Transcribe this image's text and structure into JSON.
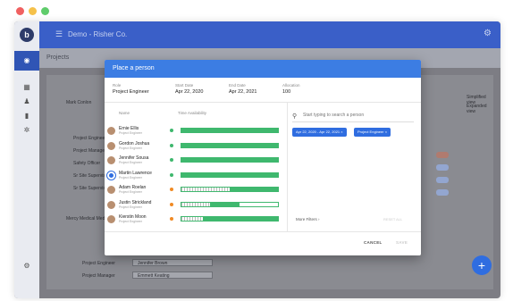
{
  "colors": {
    "dot_red": "#f06060",
    "dot_yellow": "#f5c14a",
    "dot_green": "#5fcc6b",
    "accent": "#3c7de3",
    "bar_green": "#3fb86e",
    "status_green": "#3fb86e",
    "status_orange": "#f08a24"
  },
  "app": {
    "logo_letter": "b",
    "title": "Demo - Risher Co.",
    "menu_icon": "menu-icon",
    "settings_icon": "gear-icon"
  },
  "subbar": {
    "label": "Projects"
  },
  "background": {
    "rows": [
      {
        "label": "Mark Conlon"
      },
      {
        "label": "Project Engineer"
      },
      {
        "label": "Project Manager"
      },
      {
        "label": "Safety Officer"
      },
      {
        "label": "Sr Site Supervisor"
      },
      {
        "label": "Sr Site Supervisor"
      },
      {
        "label": "Mercy Medical Medical Center"
      },
      {
        "label": "Project Engineer"
      },
      {
        "label": "Project Manager"
      }
    ],
    "right_options": [
      "Simplified view",
      "Expanded view"
    ],
    "fields": [
      "Jennifer Brown",
      "Emmett Keating"
    ]
  },
  "modal": {
    "title": "Place a person",
    "meta": [
      {
        "key": "Role",
        "value": "Project Engineer"
      },
      {
        "key": "Start Date",
        "value": "Apr 22, 2020"
      },
      {
        "key": "End Date",
        "value": "Apr 22, 2021"
      },
      {
        "key": "Allocation",
        "value": "100"
      }
    ],
    "col_name": "Name",
    "col_availability": "Time Availability",
    "people": [
      {
        "name": "Ernie Ellis",
        "role": "Project Engineer",
        "status": "green",
        "fill": 1.0,
        "hatch": 0
      },
      {
        "name": "Gordon Joshua",
        "role": "Project Engineer",
        "status": "green",
        "fill": 1.0,
        "hatch": 0
      },
      {
        "name": "Jennifer Sousa",
        "role": "Project Engineer",
        "status": "green",
        "fill": 1.0,
        "hatch": 0
      },
      {
        "name": "Martin Lawrence",
        "role": "Project Engineer",
        "status": "green",
        "fill": 1.0,
        "hatch": 0,
        "selected": true
      },
      {
        "name": "Adam Roelan",
        "role": "Project Engineer",
        "status": "orange",
        "fill": 0.5,
        "hatch": 0.5
      },
      {
        "name": "Justin Strickland",
        "role": "Project Engineer",
        "status": "orange",
        "fill": 0.3,
        "hatch": 0.3
      },
      {
        "name": "Kierstin Moon",
        "role": "Project Engineer",
        "status": "orange",
        "fill": 0.8,
        "hatch": 0.22
      }
    ],
    "search_placeholder": "Start typing to search a person",
    "search_icon": "search-icon",
    "chips": [
      {
        "label": "Apr 22, 2020 - Apr 22, 2021",
        "close": "×"
      },
      {
        "label": "Project Engineer",
        "close": "×"
      }
    ],
    "more_filters": "More Filters",
    "reset_all": "RESET ALL",
    "cancel": "CANCEL",
    "save": "SAVE"
  }
}
